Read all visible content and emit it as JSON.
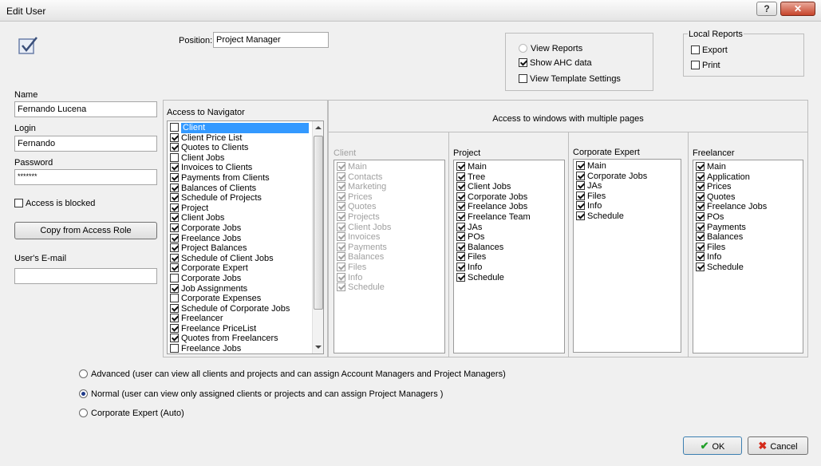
{
  "window": {
    "title": "Edit User",
    "help": "?",
    "close": "✕"
  },
  "position": {
    "label": "Position:",
    "value": "Project Manager"
  },
  "reports": {
    "view_reports": {
      "label": "View Reports",
      "checked": false
    },
    "show_ahc": {
      "label": "Show AHC data",
      "checked": true
    },
    "view_template": {
      "label": "View Template Settings",
      "checked": false
    }
  },
  "local_reports": {
    "title": "Local Reports",
    "export": {
      "label": "Export",
      "checked": false
    },
    "print": {
      "label": "Print",
      "checked": false
    }
  },
  "user": {
    "name_label": "Name",
    "name_value": "Fernando Lucena",
    "login_label": "Login",
    "login_value": "Fernando",
    "password_label": "Password",
    "password_value": "*******",
    "blocked_label": "Access is blocked",
    "copy_button": "Copy from Access Role",
    "email_label": "User's E-mail",
    "email_value": ""
  },
  "navigator": {
    "title": "Access to Navigator",
    "items": [
      {
        "label": "Client",
        "checked": false,
        "selected": true
      },
      {
        "label": "Client Price List",
        "checked": true
      },
      {
        "label": "Quotes to Clients",
        "checked": true
      },
      {
        "label": "Client Jobs",
        "checked": false
      },
      {
        "label": "Invoices to Clients",
        "checked": true
      },
      {
        "label": "Payments from Clients",
        "checked": true
      },
      {
        "label": "Balances of Clients",
        "checked": true
      },
      {
        "label": "Schedule of Projects",
        "checked": true
      },
      {
        "label": "Project",
        "checked": true
      },
      {
        "label": "Client Jobs",
        "checked": true
      },
      {
        "label": "Corporate Jobs",
        "checked": true
      },
      {
        "label": "Freelance Jobs",
        "checked": true
      },
      {
        "label": "Project Balances",
        "checked": true
      },
      {
        "label": "Schedule of Client Jobs",
        "checked": true
      },
      {
        "label": "Corporate Expert",
        "checked": true
      },
      {
        "label": "Corporate Jobs",
        "checked": false
      },
      {
        "label": "Job Assignments",
        "checked": true
      },
      {
        "label": "Corporate Expenses",
        "checked": false
      },
      {
        "label": "Schedule of Corporate Jobs",
        "checked": true
      },
      {
        "label": "Freelancer",
        "checked": true
      },
      {
        "label": "Freelance PriceList",
        "checked": true
      },
      {
        "label": "Quotes from Freelancers",
        "checked": true
      },
      {
        "label": "Freelance Jobs",
        "checked": false
      }
    ]
  },
  "windows": {
    "title": "Access to windows with multiple pages",
    "columns": [
      {
        "title": "Client",
        "disabled": true,
        "items": [
          "Main",
          "Contacts",
          "Marketing",
          "Prices",
          "Quotes",
          "Projects",
          "Client Jobs",
          "Invoices",
          "Payments",
          "Balances",
          "Files",
          "Info",
          "Schedule"
        ]
      },
      {
        "title": "Project",
        "disabled": false,
        "items": [
          "Main",
          "Tree",
          "Client Jobs",
          "Corporate Jobs",
          "Freelance Jobs",
          "Freelance Team",
          "JAs",
          "POs",
          "Balances",
          "Files",
          "Info",
          "Schedule"
        ]
      },
      {
        "title": "Corporate Expert",
        "disabled": false,
        "items": [
          "Main",
          "Corporate Jobs",
          "JAs",
          "Files",
          "Info",
          "Schedule"
        ]
      },
      {
        "title": "Freelancer",
        "disabled": false,
        "items": [
          "Main",
          "Application",
          "Prices",
          "Quotes",
          "Freelance Jobs",
          "POs",
          "Payments",
          "Balances",
          "Files",
          "Info",
          "Schedule"
        ]
      }
    ]
  },
  "modes": [
    {
      "label": "Advanced (user can view all clients and projects and can assign Account Managers and Project Managers)",
      "selected": false
    },
    {
      "label": "Normal (user can view only assigned clients or projects and can assign Project Managers )",
      "selected": true
    },
    {
      "label": "Corporate Expert (Auto)",
      "selected": false
    }
  ],
  "footer": {
    "ok": "OK",
    "cancel": "Cancel"
  },
  "colors": {
    "ok_check": "#22a02a",
    "cancel_x": "#d42a1a",
    "selection": "#3399ff"
  }
}
